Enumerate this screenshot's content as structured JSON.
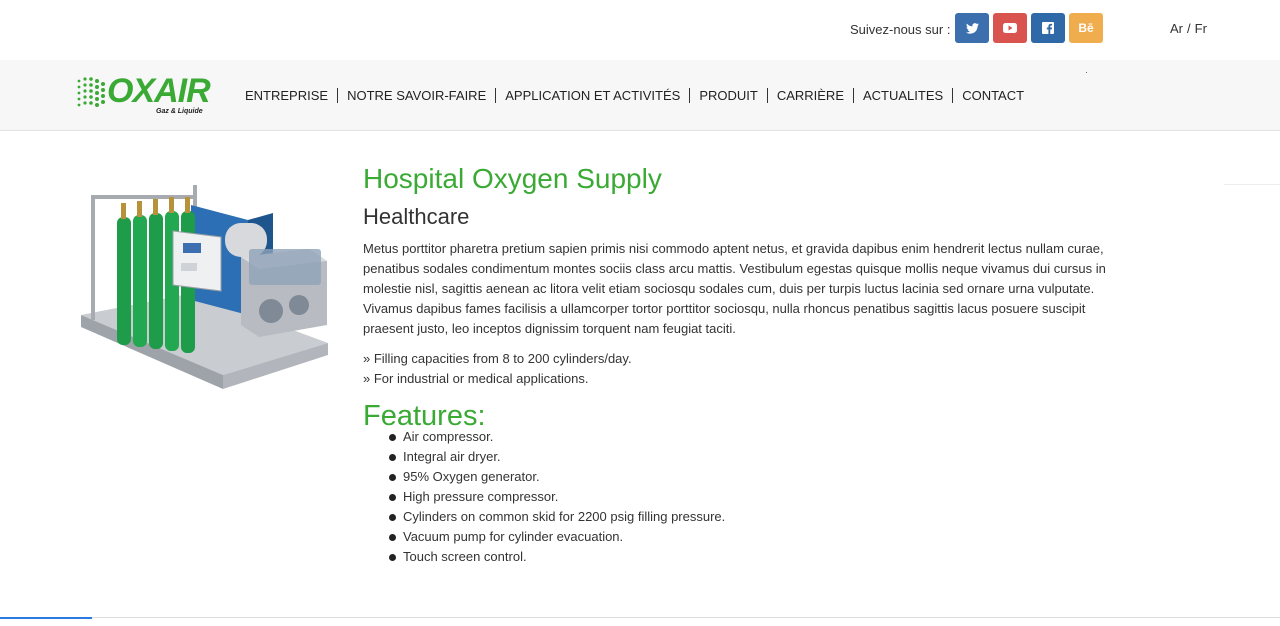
{
  "topbar": {
    "follow_label": "Suivez-nous sur :",
    "social": [
      {
        "name": "twitter-icon",
        "color": "#3b6fad"
      },
      {
        "name": "youtube-icon",
        "color": "#d9534f"
      },
      {
        "name": "facebook-icon",
        "color": "#3069a8"
      },
      {
        "name": "behance-icon",
        "label": "Bē",
        "color": "#f0ad4e"
      }
    ],
    "lang_ar": "Ar",
    "lang_sep": "/",
    "lang_fr": "Fr"
  },
  "logo": {
    "text": "OXAIR",
    "sub": "Gaz & Liquide",
    "color": "#3aaa35"
  },
  "nav": [
    "ENTREPRISE",
    "NOTRE SAVOIR-FAIRE",
    "APPLICATION ET ACTIVITÉS",
    "PRODUIT",
    "CARRIÈRE",
    "ACTUALITES",
    "CONTACT"
  ],
  "product": {
    "title": "Hospital Oxygen Supply",
    "subtitle": "Healthcare",
    "description": "Metus porttitor pharetra pretium sapien primis nisi commodo aptent netus, et gravida dapibus enim hendrerit lectus nullam curae, penatibus sodales condimentum montes sociis class arcu mattis. Vestibulum egestas quisque mollis neque vivamus dui cursus in molestie nisl, sagittis aenean ac litora velit etiam sociosqu sodales cum, duis per turpis luctus lacinia sed ornare urna vulputate. Vivamus dapibus fames facilisis a ullamcorper tortor porttitor sociosqu, nulla rhoncus penatibus sagittis lacus posuere suscipit praesent justo, leo inceptos dignissim torquent nam feugiat taciti.",
    "bullets": [
      "» Filling capacities from 8 to 200 cylinders/day.",
      "» For industrial or medical applications."
    ],
    "features_title": "Features:",
    "features": [
      "Air compressor.",
      "Integral air dryer.",
      "95% Oxygen generator.",
      "High pressure compressor.",
      "Cylinders on common skid for 2200 psig filling pressure.",
      "Vacuum pump for cylinder evacuation.",
      "Touch screen control."
    ]
  },
  "colors": {
    "accent": "#3aaa35",
    "nav_bg": "#f7f7f7"
  }
}
